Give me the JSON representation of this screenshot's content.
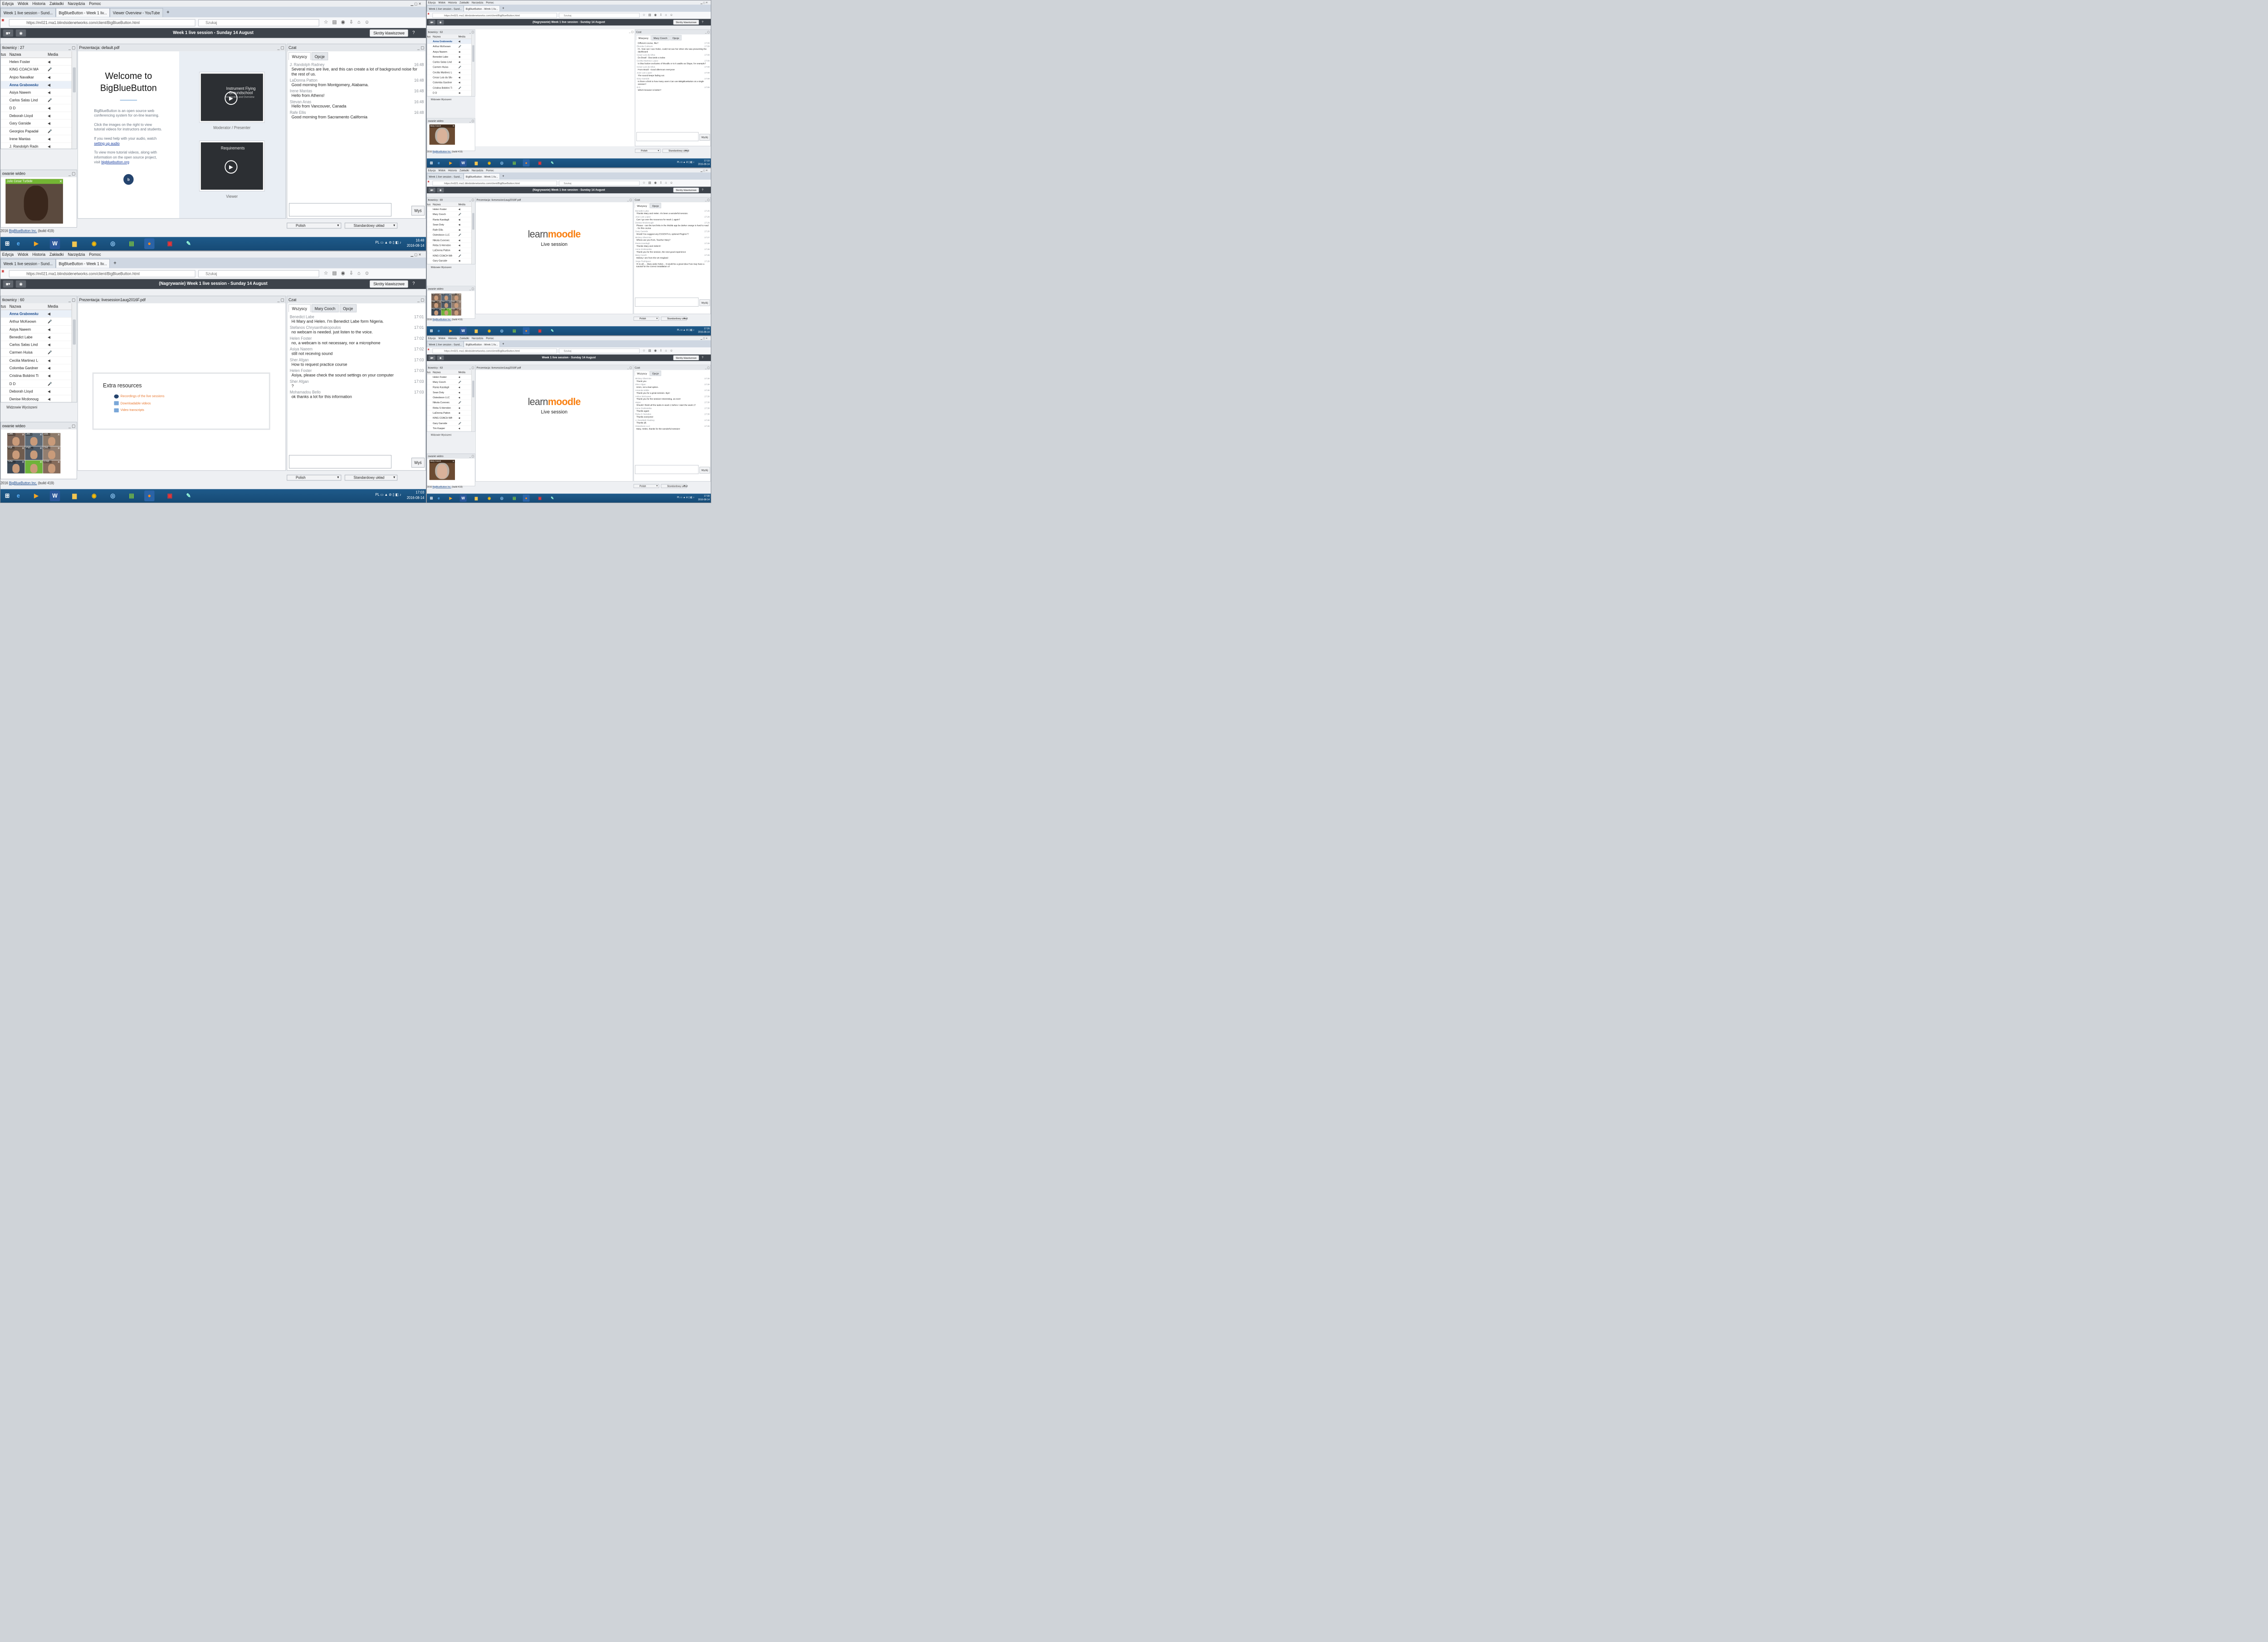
{
  "menu": [
    "Edycja",
    "Widok",
    "Historia",
    "Zakładki",
    "Narzędzia",
    "Pomoc"
  ],
  "url": "https://m021.rna1.blindsidenetworks.com/client/BigBlueButton.html",
  "url_host": "blindsidenetworks.com",
  "search_placeholder": "Szukaj",
  "shortcuts_label": "Skróty klawiszowe",
  "help_label": "?",
  "users_col_status": "tus",
  "users_col_name": "Nazwa",
  "users_col_media": "Media",
  "hidden_webcams": "Widzowie Wyciszeni",
  "video_header": "owanie wideo",
  "chat_header": "Czat",
  "tab_all": "Wszyscy",
  "tab_options": "Opcje",
  "send_label": "Wyślij",
  "send_short": "Wyś",
  "lang_select": "Polish",
  "layout_select": "Standardowy układ",
  "footer_year": "2016",
  "footer_link": "BigBlueButton Inc.",
  "footer_build": "(build 419)",
  "taskbar_lang": "PL",
  "screens": {
    "s1": {
      "tabs": [
        "Week 1 live session - Sund...",
        "BigBlueButton - Week 1 liv...",
        "Viewer Overview - YouTube"
      ],
      "title": "Week 1 live session - Sunday 14 August",
      "users_header": "tkownicy : 27",
      "users": [
        "Helen Foster",
        "KING COACH MAU",
        "Anjoo Navalkar",
        "Anna Grabowska",
        "Asiya Naeem",
        "Carlos Salas Lind",
        "D D",
        "Deborah Lloyd",
        "Gary Garside",
        "Georgios Papadak",
        "Irene Mantas",
        "J. Randolph Radne"
      ],
      "pres_header": "Prezentacja: default.pdf",
      "welcome_title": "Welcome to BigBlueButton",
      "welcome_p1": "BigBlueButton is an open source web conferencing system for on-line learning.",
      "welcome_p2": "Click the images on the right to view tutorial videos for instructors and students.",
      "welcome_p3": "If you need help with your audio, watch",
      "welcome_link1": "setting up audio",
      "welcome_p4": "To view more tutorial videos, along with information on the open source project, visit",
      "welcome_link2": "bigbluebutton.org",
      "thumb1_title": "Instrument Flying Groundschool",
      "thumb1_sub": "Introduction and Overview",
      "thumb1_caption": "Moderator / Presenter",
      "thumb2_title": "Requirements",
      "thumb2_caption": "Viewer",
      "video_user": "Julio Cesar Turbide",
      "chat": [
        {
          "u": "J. Randolph Radney",
          "t": "16:48",
          "m": "Several mics are live, and this can create a lot of background noise for the rest of us."
        },
        {
          "u": "LaDonna Patton",
          "t": "16:48",
          "m": "Good morning from Montgomery, Alabama."
        },
        {
          "u": "Irene Mantas",
          "t": "16:48",
          "m": "Hello from Athens!"
        },
        {
          "u": "Stevan Anas",
          "t": "16:48",
          "m": "Hello from Vancouver, Canada"
        },
        {
          "u": "Rafe Ellis",
          "t": "16:48",
          "m": "Good morning from Sacramento California"
        }
      ],
      "clock_time": "16:48",
      "clock_date": "2016-08-14"
    },
    "s2": {
      "tabs": [
        "Week 1 live session - Sund...",
        "BigBlueButton - Week 1 liv..."
      ],
      "title": "(Nagrywanie) Week 1 live session - Sunday 14 August",
      "users_header": "tkownicy : 60",
      "users": [
        "Anna Grabowska",
        "Arthur McKeown",
        "Asiya Naeem",
        "Benedict Labe",
        "Carlos Salas Lind",
        "Carmen Huisa",
        "Cecilia Martinez Lop",
        "Colomba Gardner",
        "Cristina Boldrini Tisc",
        "D D",
        "Deborah Lloyd",
        "Denise Mcdonough"
      ],
      "pres_header": "Prezentacja: livesession1aug2016F.pdf",
      "extra_title": "Extra resources",
      "extra_items": [
        "Recordings of the live sessions",
        "Downloadable videos",
        "Video transcripts"
      ],
      "private_tab": "Mary Cooch",
      "video_cells": [
        "Deb...",
        "Jos...",
        "Juli...",
        "Raf...",
        "Patr...",
        "Ost...",
        "She...",
        "",
        "Crist..."
      ],
      "chat": [
        {
          "u": "Benedict Labe",
          "t": "17:01",
          "m": "Hi Mary and Helen. I'm Benedict Labe form Nigeria."
        },
        {
          "u": "Stefanos Chrysanthakopoulos",
          "t": "17:01",
          "m": "no webcam is needed. just listen to the voice."
        },
        {
          "u": "Helen Foster",
          "t": "17:02",
          "m": "no, a webcam is not necessary, nor a microphone"
        },
        {
          "u": "Asiya Naeem",
          "t": "17:02",
          "m": "still not receving sound"
        },
        {
          "u": "Sher Afgan",
          "t": "17:03",
          "m": "How to request practice course"
        },
        {
          "u": "Helen Foster",
          "t": "17:03",
          "m": "Asiya, please check the sound settings on your computer"
        },
        {
          "u": "Sher Afgan",
          "t": "17:03",
          "m": "?"
        },
        {
          "u": "Mohamadou Bello",
          "t": "17:03",
          "m": "ok thanks a lot for this information"
        }
      ],
      "clock_time": "17:03",
      "clock_date": "2016-08-14"
    },
    "s3": {
      "tabs": [
        "Week 1 live session - Sund...",
        "BigBlueButton - Week 1 liv..."
      ],
      "title": "(Nagrywanie) Week 1 live session - Sunday 14 August",
      "users_header": "tkownicy : 63",
      "users": [
        "Anna Grabowska",
        "Arthur McKeown",
        "Asiya Naeem",
        "Benedict Labe",
        "Carlos Salas Lind",
        "Carmen Huisa",
        "Cecilia Martinez Lop",
        "Cesar Luis da Silva",
        "Colomba Gardner",
        "Cristina Boldrini Ti",
        "D D",
        "Deborah Lloyd"
      ],
      "private_tab": "Mary Cooch",
      "video_user": "Mary Cooch",
      "chat": [
        {
          "u": "",
          "t": "17:09",
          "m": "Different course, like?"
        },
        {
          "u": "Ebonita Curkovic",
          "t": "17:09",
          "m": "Hi , how can I see Helen, could not see her when she was presenting the dashboard"
        },
        {
          "u": "Cesar Luis da Silva",
          "t": "17:09",
          "m": "Do Brasil - Boa tarde a todos"
        },
        {
          "u": "Cecilia Martinez Lopez",
          "t": "17:09",
          "m": "Is blue button exclusive of Moodle or is it usable as Skype, for example?"
        },
        {
          "u": "Cesar Luis da Silva",
          "t": "17:09",
          "m": "From Brazil - Good afternoon everyone"
        },
        {
          "u": "Jose Luis Lopez",
          "t": "17:09",
          "m": "The sound keeps fading out."
        },
        {
          "u": "Gary Garside",
          "t": "17:09",
          "m": "Is there a limit to how many users Can use BBigBlueButton at a single session?"
        },
        {
          "u": "D D",
          "t": "17:09",
          "m": "Which browser is better?"
        }
      ],
      "clock_time": "17:10",
      "clock_date": "2016-08-14"
    },
    "s4": {
      "tabs": [
        "Week 1 live session - Sund...",
        "BigBlueButton - Week 1 liv..."
      ],
      "title": "(Nagrywanie) Week 1 live session - Sunday 14 August",
      "users_header": "tkownicy : 69",
      "users": [
        "Helen Foster",
        "Mary Cooch",
        "Rania Kasdagli",
        "Sean Doty",
        "Rafe Ellis",
        "Osteoboon LLC",
        "Nikola Cvorovic",
        "Reba S Herndon",
        "LaDonna Patton",
        "KING COACH MAUD",
        "Gary Garside",
        "Tim Kasper"
      ],
      "pres_header": "Prezentacja: livesession1aug2016F.pdf",
      "learn": "learn",
      "moodle": "moodle",
      "live_session": "Live session",
      "video_cells": [
        "Raf",
        "Ost",
        "Ann...",
        "Deb...",
        "Joe",
        "Juli...",
        "Pan",
        "Rob...",
        "Stef..."
      ],
      "chat": [
        {
          "u": "Benedict Labe",
          "t": "17:25",
          "m": "Thanks Mary and Helen. It's been a wonderful session."
        },
        {
          "u": "Jose Luis Lopez",
          "t": "17:26",
          "m": "Can I go over the resources for week 1 again?"
        },
        {
          "u": "Denise Mcdonough",
          "t": "17:26",
          "m": "Please - can the text links in the Mobile app be darker orange is hard to read - for this course"
        },
        {
          "u": "Gary Garside",
          "t": "17:26",
          "m": "Would You suggest any ESSENTIAL optional Plugins??"
        },
        {
          "u": "Mickey Obermire",
          "t": "17:27",
          "m": "Where are you from, Teacher Mary?"
        },
        {
          "u": "Rania Kasdagli",
          "t": "17:28",
          "m": "Thanks Mary and Helen!!!"
        },
        {
          "u": "Anna Grabowska",
          "t": "17:28",
          "m": "Thank you for the session, the next good experience"
        },
        {
          "u": "Mary Cooch",
          "t": "17:28",
          "m": "Mickey I am from the UK England"
        },
        {
          "u": "Jorge Rodriguez",
          "t": "17:28",
          "m": "Hi to all..... Mary ande Helen... It would be a great idea if we may have a tutorial for the correct installation of"
        }
      ],
      "clock_time": "17:26",
      "clock_date": "2016-08-14"
    },
    "s5": {
      "tabs": [
        "Week 1 live session - Sund...",
        "BigBlueButton - Week 1 liv..."
      ],
      "title": "Week 1 live session - Sunday 14 August",
      "users_header": "tkownicy : 63",
      "users": [
        "Helen Foster",
        "Mary Cooch",
        "Rania Kasdagli",
        "Sean Doty",
        "Osteoboon LLC",
        "Nikola Cvorovic",
        "Reba S Herndon",
        "LaDonna Patton",
        "KING COACH MAUD",
        "Gary Garside",
        "Tim Kasper",
        "Cesar Luis da Silva"
      ],
      "pres_header": "Prezentacja: livesession1aug2016F.pdf",
      "learn": "learn",
      "moodle": "moodle",
      "live_session": "Live session",
      "video_user": "Mary Cooch",
      "chat": [
        {
          "u": "Mickey Obermire",
          "t": "17:30",
          "m": "Thank you"
        },
        {
          "u": "Sher Afgan",
          "t": "17:30",
          "m": "Hmm, not a bad option."
        },
        {
          "u": "Amanda Wittle",
          "t": "17:30",
          "m": "Thank you for a great session.  Bye!"
        },
        {
          "u": "Arthur McKeown",
          "t": "17:30",
          "m": "Thank you for the session! Interesting, as ever!"
        },
        {
          "u": "xiejun",
          "t": "17:30",
          "m": "Should I finish all the tasks in week 1 before I start the week 2?"
        },
        {
          "u": "Anna Grabowska",
          "t": "17:30",
          "m": "Thanks again"
        },
        {
          "u": "Reba S Herndon",
          "t": "17:30",
          "m": "Thanks everyone!"
        },
        {
          "u": "J. Randolph Radney",
          "t": "17:30",
          "m": "Thanks all."
        },
        {
          "u": "Osteoboon LLC",
          "t": "17:30",
          "m": "Mary, Helen, thanks for the wonderful session!"
        }
      ],
      "clock_time": "17:30",
      "clock_date": "2016-08-14"
    }
  }
}
